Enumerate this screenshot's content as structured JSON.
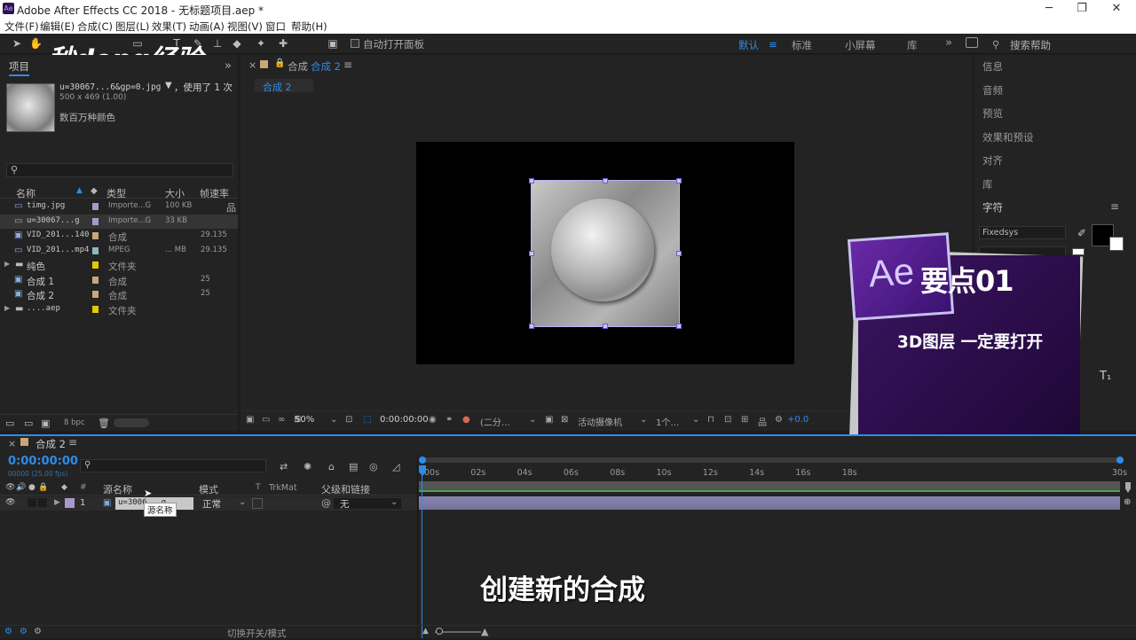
{
  "app": {
    "title": "Adobe After Effects CC 2018 - 无标题项目.aep *",
    "icon": "Ae"
  },
  "window_controls": {
    "minimize": "─",
    "maximize": "❐",
    "close": "✕"
  },
  "menu": [
    "文件(F)",
    "编辑(E)",
    "合成(C)",
    "图层(L)",
    "效果(T)",
    "动画(A)",
    "视图(V)",
    "窗口",
    "帮助(H)"
  ],
  "toolbar": {
    "auto_open_label": "自动打开面板",
    "workspaces": [
      "默认",
      "标准",
      "小屏幕",
      "库"
    ],
    "active_workspace": "默认",
    "search_placeholder": "搜索帮助"
  },
  "watermark": "秒dong经验",
  "project": {
    "tab": "项目",
    "selected": {
      "name": "u=30067...6&gp=0.jpg",
      "used": "，使用了 1 次",
      "dims": "500 x 469 (1.00)",
      "colors": "数百万种颜色"
    },
    "search_placeholder": "",
    "columns": [
      "名称",
      "类型",
      "大小",
      "帧速率"
    ],
    "items": [
      {
        "name": "timg.jpg",
        "type": "Importe...G",
        "size": "100 KB",
        "fps": "",
        "color": "#a89ac8"
      },
      {
        "name": "u=30067...g",
        "type": "Importe...G",
        "size": "33 KB",
        "fps": "",
        "color": "#a89ac8"
      },
      {
        "name": "VID_201...140",
        "type": "合成",
        "size": "",
        "fps": "29.135",
        "color": "#c8a878"
      },
      {
        "name": "VID_201...mp4",
        "type": "MPEG",
        "size": "... MB",
        "fps": "29.135",
        "color": "#8ab8c0"
      },
      {
        "name": "纯色",
        "type": "文件夹",
        "size": "",
        "fps": "",
        "color": "#e6c800"
      },
      {
        "name": "合成 1",
        "type": "合成",
        "size": "",
        "fps": "25",
        "color": "#c8a878"
      },
      {
        "name": "合成 2",
        "type": "合成",
        "size": "",
        "fps": "25",
        "color": "#c8a878"
      },
      {
        "name": "....aep",
        "type": "文件夹",
        "size": "",
        "fps": "",
        "color": "#e6c800"
      }
    ],
    "bpc": "8 bpc"
  },
  "composition": {
    "tab": "合成",
    "tab_name": "合成 2",
    "breadcrumb": "合成 2",
    "zoom": "50%",
    "timecode": "0:00:00:00",
    "resolution": "(二分…",
    "camera": "活动摄像机",
    "views": "1个…",
    "exposure": "+0.0"
  },
  "right_panel": {
    "items": [
      "信息",
      "音频",
      "预览",
      "效果和预设",
      "对齐",
      "库"
    ],
    "character_title": "字符",
    "font": "Fixedsys"
  },
  "overlay": {
    "logo": "Ae",
    "title": "要点01",
    "text": "3D图层 一定要打开"
  },
  "timeline": {
    "tab": "合成 2",
    "timecode": "0:00:00:00",
    "fps_sub": "00000 (25.00 fps)",
    "columns": {
      "num": "#",
      "source": "源名称",
      "mode": "模式",
      "t": "T",
      "trkmat": "TrkMat",
      "parent": "父级和链接"
    },
    "layer": {
      "num": "1",
      "name": "u=3006...g",
      "mode": "正常",
      "parent": "无"
    },
    "tooltip": "源名称",
    "ruler": [
      "00s",
      "02s",
      "04s",
      "06s",
      "08s",
      "10s",
      "12s",
      "14s",
      "16s",
      "18s",
      "30s"
    ],
    "bottom_label": "切换开关/模式"
  },
  "subtitle": "创建新的合成"
}
